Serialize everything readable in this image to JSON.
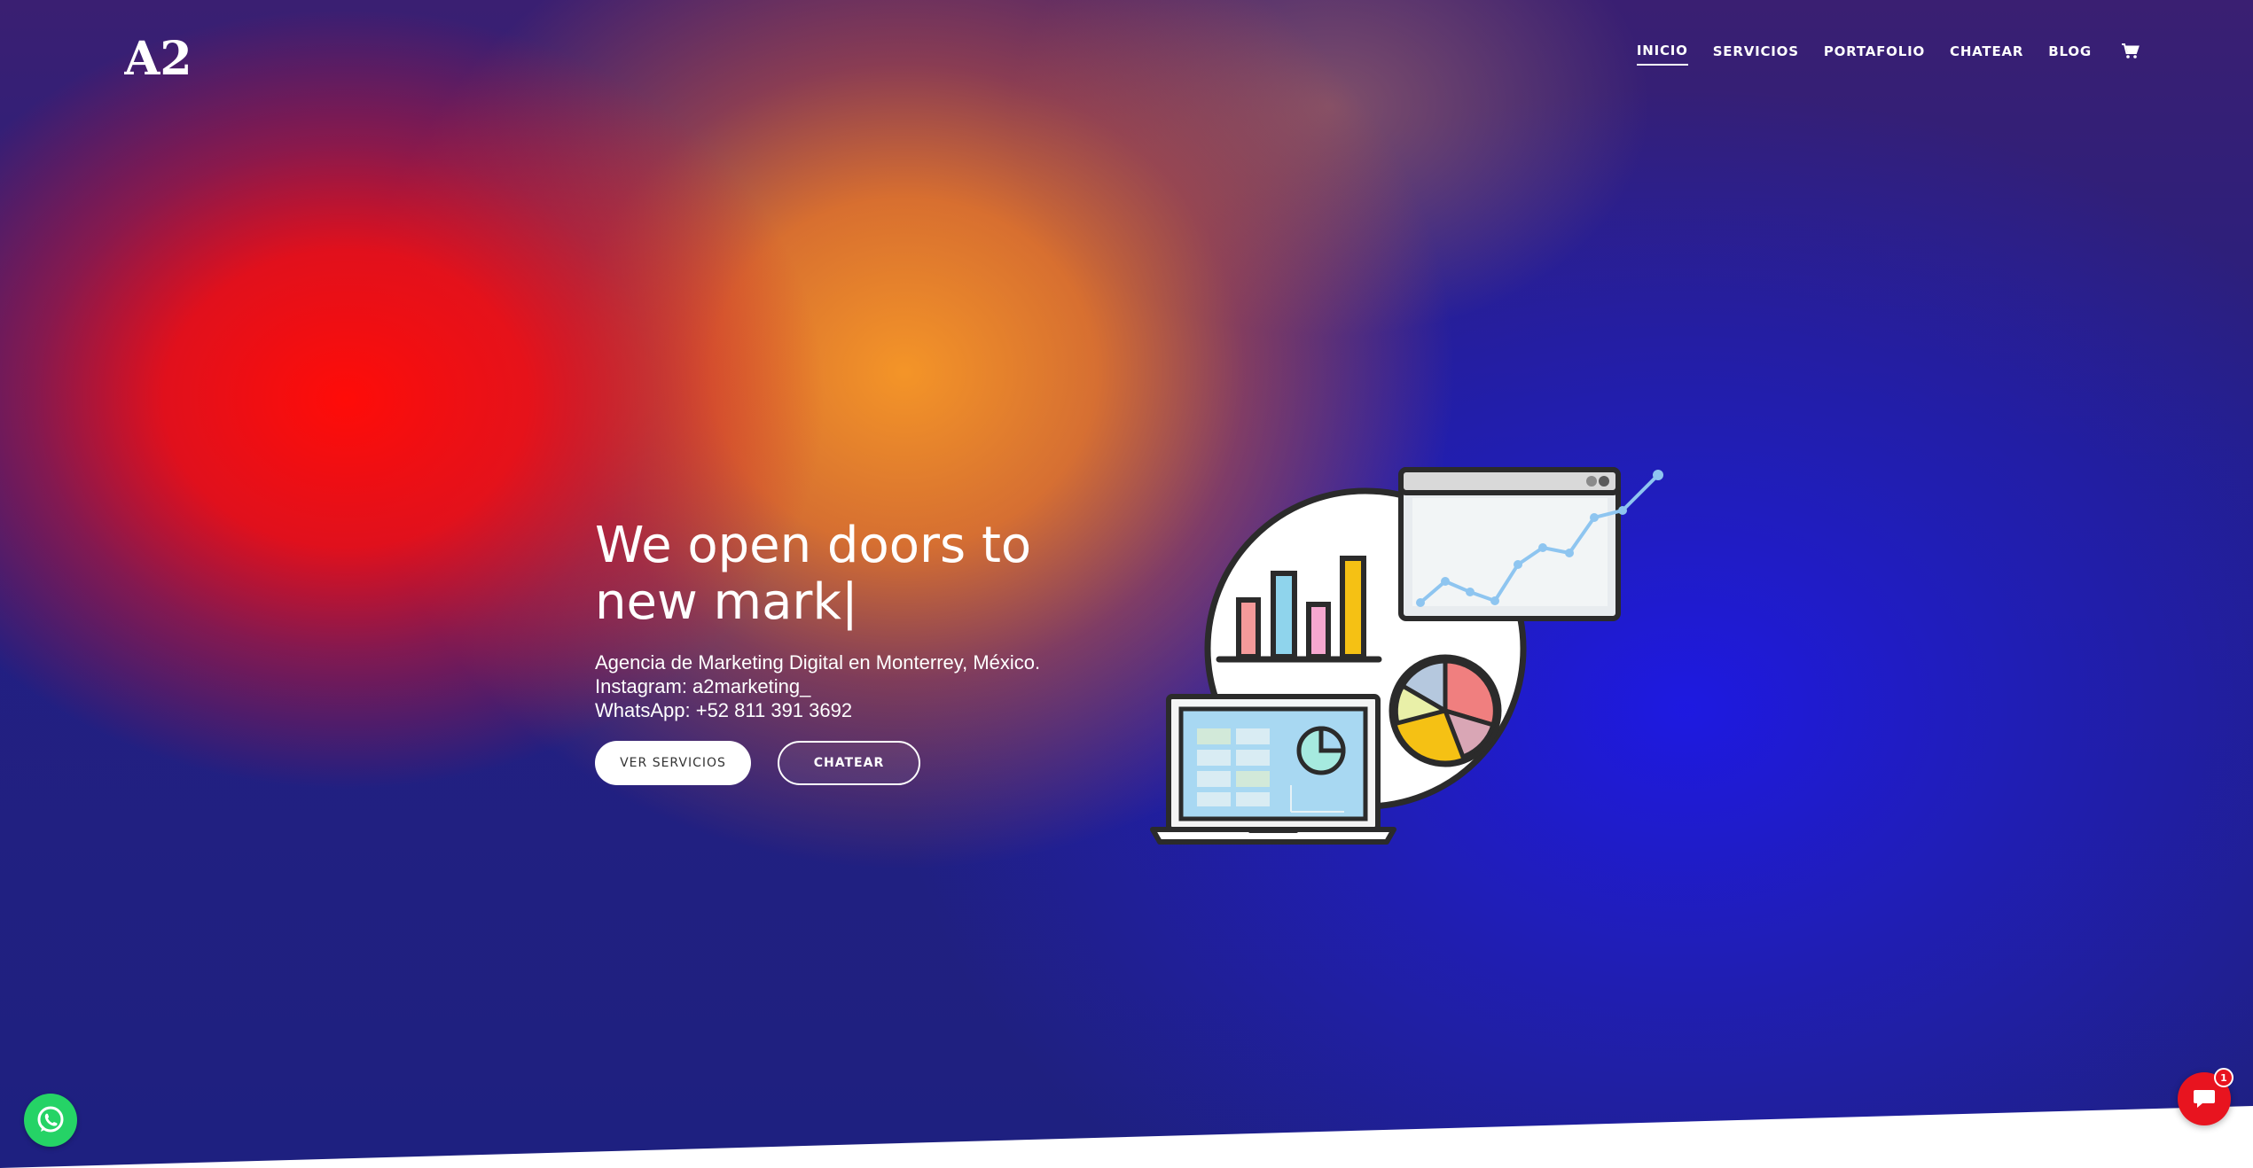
{
  "brand": {
    "logo_text": "A2"
  },
  "nav": {
    "items": [
      {
        "label": "INICIO",
        "active": true
      },
      {
        "label": "SERVICIOS",
        "active": false
      },
      {
        "label": "PORTAFOLIO",
        "active": false
      },
      {
        "label": "CHATEAR",
        "active": false
      },
      {
        "label": "BLOG",
        "active": false
      }
    ],
    "cart_icon": "shopping-cart-icon"
  },
  "hero": {
    "headline_line1": "We open doors to",
    "headline_line2": "new mark|",
    "tagline": "Agencia de Marketing Digital en Monterrey, México.",
    "instagram": "Instagram: a2marketing_",
    "whatsapp": "WhatsApp: +52 811 391 3692",
    "primary_button": "VER SERVICIOS",
    "secondary_button": "CHATEAR"
  },
  "floating": {
    "whatsapp_icon": "whatsapp-icon",
    "chat_icon": "chat-icon",
    "chat_badge_count": "1"
  },
  "colors": {
    "accent_red": "#e8141f",
    "whatsapp_green": "#25d366",
    "background_blue": "#1f1f7a",
    "gradient_red": "#ff0c08",
    "gradient_orange": "#f59322"
  }
}
